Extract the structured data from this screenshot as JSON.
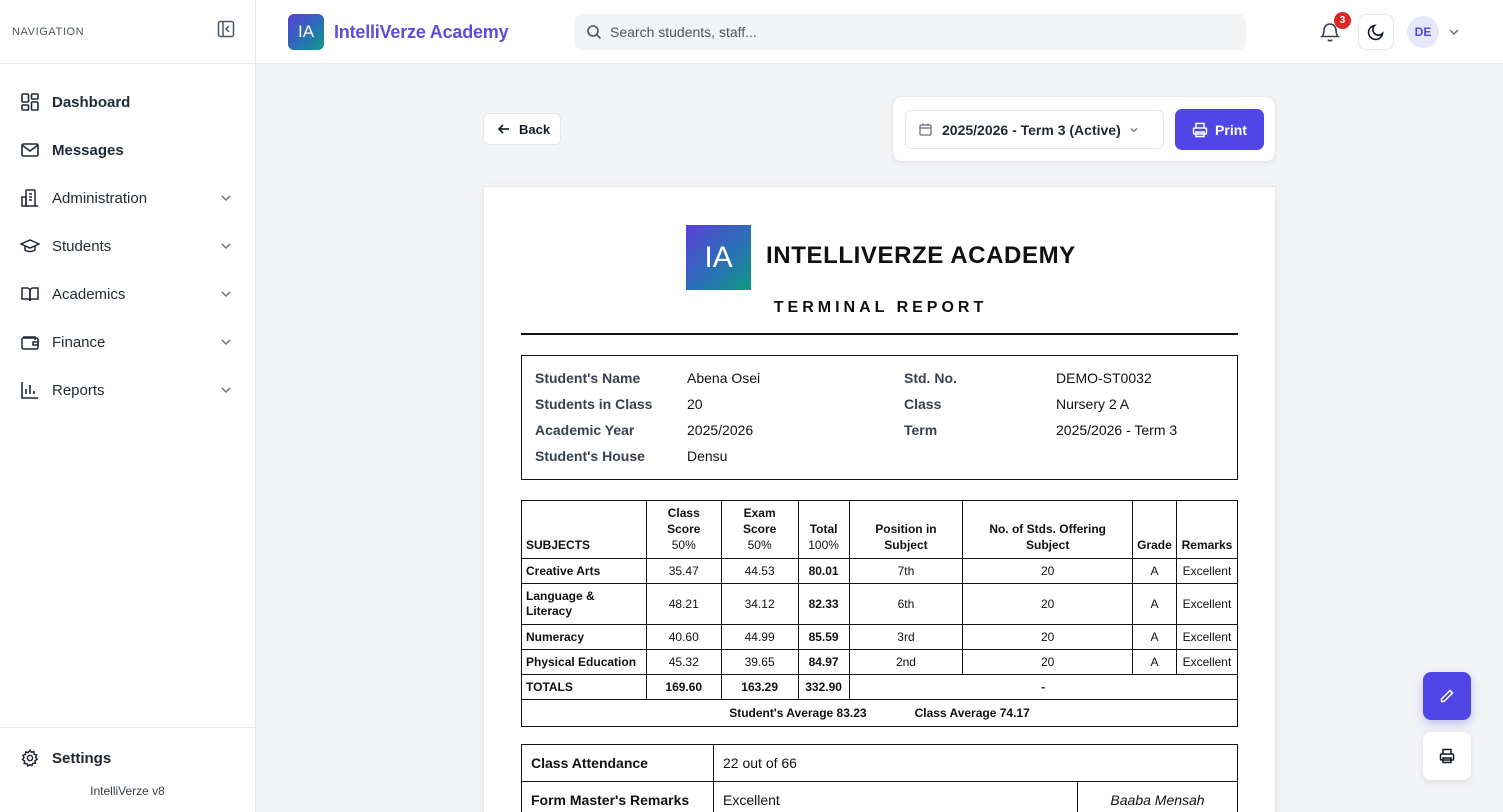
{
  "sidebar": {
    "heading": "NAVIGATION",
    "items": [
      {
        "label": "Dashboard",
        "icon": "dashboard-icon"
      },
      {
        "label": "Messages",
        "icon": "mail-icon"
      },
      {
        "label": "Administration",
        "icon": "building-icon"
      },
      {
        "label": "Students",
        "icon": "graduation-cap-icon"
      },
      {
        "label": "Academics",
        "icon": "book-icon"
      },
      {
        "label": "Finance",
        "icon": "wallet-icon"
      },
      {
        "label": "Reports",
        "icon": "bar-chart-icon"
      }
    ],
    "settings_label": "Settings",
    "version": "IntelliVerze v8"
  },
  "header": {
    "logo_text": "IA",
    "brand": "IntelliVerze Academy",
    "search_placeholder": "Search students, staff...",
    "notification_count": "3",
    "avatar_initials": "DE"
  },
  "toolbar": {
    "back_label": "Back",
    "term_value": "2025/2026 - Term 3 (Active)",
    "print_label": "Print"
  },
  "report": {
    "logo_text": "IA",
    "school_name": "INTELLIVERZE ACADEMY",
    "title": "TERMINAL REPORT",
    "info": {
      "name_label": "Student's Name",
      "name": "Abena Osei",
      "count_label": "Students in Class",
      "count": "20",
      "year_label": "Academic Year",
      "year": "2025/2026",
      "house_label": "Student's House",
      "house": "Densu",
      "stdno_label": "Std. No.",
      "stdno": "DEMO-ST0032",
      "class_label": "Class",
      "class": "Nursery 2 A",
      "term_label": "Term",
      "term": "2025/2026 - Term 3"
    },
    "table": {
      "headers": {
        "subjects": "SUBJECTS",
        "class_score": "Class Score",
        "class_score_sub": "50%",
        "exam_score": "Exam Score",
        "exam_score_sub": "50%",
        "total": "Total",
        "total_sub": "100%",
        "position": "Position in Subject",
        "offering": "No. of Stds. Offering Subject",
        "grade": "Grade",
        "remarks": "Remarks"
      },
      "rows": [
        {
          "subject": "Creative Arts",
          "class": "35.47",
          "exam": "44.53",
          "total": "80.01",
          "position": "7th",
          "offering": "20",
          "grade": "A",
          "remark": "Excellent"
        },
        {
          "subject": "Language & Literacy",
          "class": "48.21",
          "exam": "34.12",
          "total": "82.33",
          "position": "6th",
          "offering": "20",
          "grade": "A",
          "remark": "Excellent"
        },
        {
          "subject": "Numeracy",
          "class": "40.60",
          "exam": "44.99",
          "total": "85.59",
          "position": "3rd",
          "offering": "20",
          "grade": "A",
          "remark": "Excellent"
        },
        {
          "subject": "Physical Education",
          "class": "45.32",
          "exam": "39.65",
          "total": "84.97",
          "position": "2nd",
          "offering": "20",
          "grade": "A",
          "remark": "Excellent"
        }
      ],
      "totals": {
        "label": "TOTALS",
        "class": "169.60",
        "exam": "163.29",
        "total": "332.90",
        "rest": "-"
      },
      "student_average": "Student's Average 83.23",
      "class_average": "Class Average 74.17"
    },
    "attendance_label": "Class Attendance",
    "attendance": "22 out of 66",
    "form_master_label": "Form Master's Remarks",
    "form_master_remark": "Excellent",
    "form_master_name": "Baaba Mensah"
  },
  "colors": {
    "accent": "#4f46e5",
    "badge": "#dc2626"
  }
}
